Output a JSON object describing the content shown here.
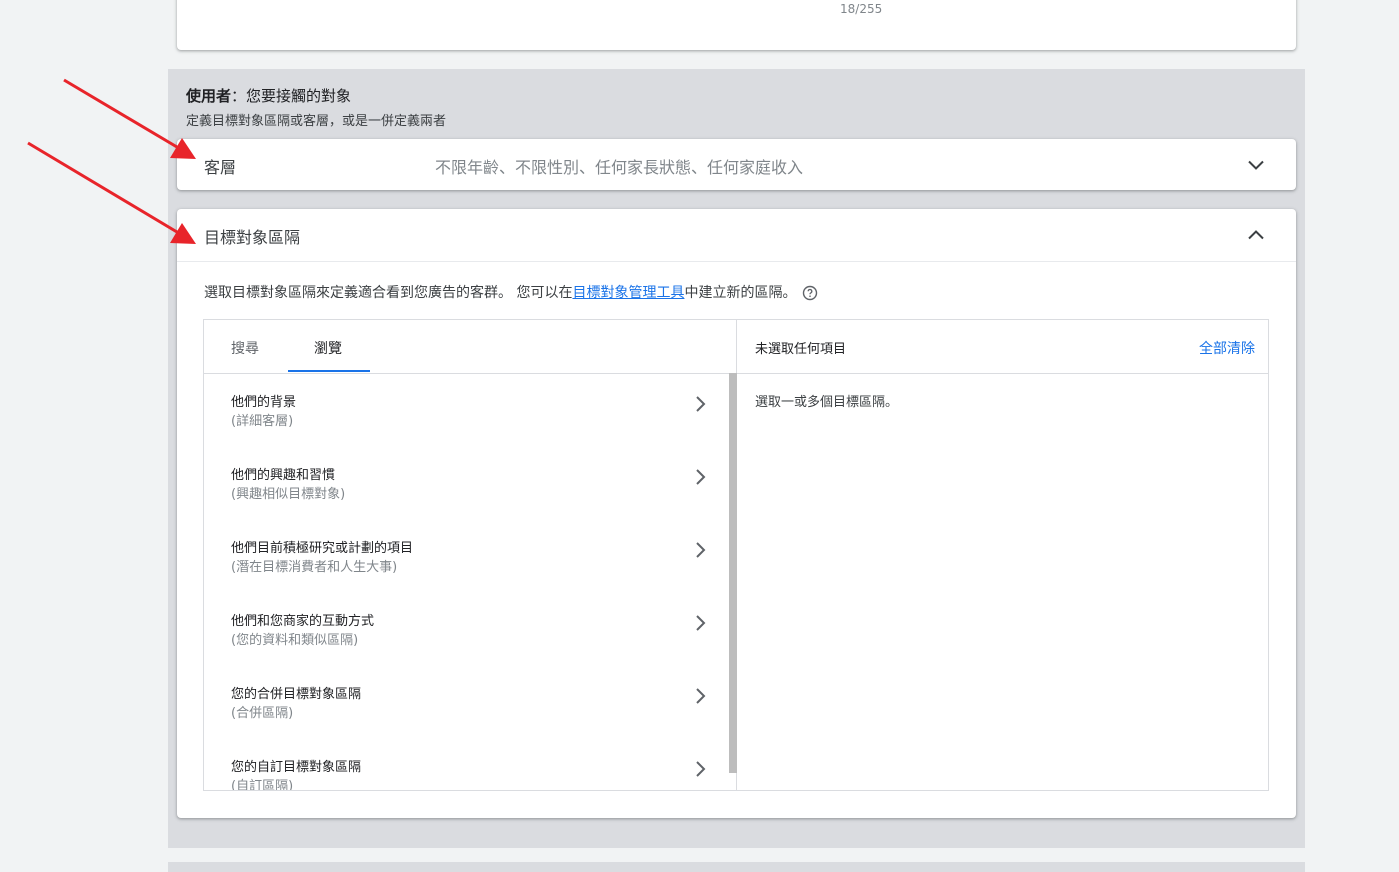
{
  "top_card": {
    "char_count": "18/255"
  },
  "section": {
    "title_bold": "使用者",
    "title_rest": "：您要接觸的對象",
    "subtitle": "定義目標對象區隔或客層，或是一併定義兩者"
  },
  "demographics": {
    "label": "客層",
    "summary": "不限年齡、不限性別、任何家長狀態、任何家庭收入"
  },
  "audience": {
    "label": "目標對象區隔",
    "desc_before": "選取目標對象區隔來定義適合看到您廣告的客群。 您可以在",
    "desc_link": "目標對象管理工具",
    "desc_after": "中建立新的區隔。",
    "tabs": [
      "搜尋",
      "瀏覽"
    ],
    "active_tab": "瀏覽",
    "items": [
      {
        "title": "他們的背景",
        "subtitle": "(詳細客層)"
      },
      {
        "title": "他們的興趣和習慣",
        "subtitle": "(興趣相似目標對象)"
      },
      {
        "title": "他們目前積極研究或計劃的項目",
        "subtitle": "(潛在目標消費者和人生大事)"
      },
      {
        "title": "他們和您商家的互動方式",
        "subtitle": "(您的資料和類似區隔)"
      },
      {
        "title": "您的合併目標對象區隔",
        "subtitle": "(合併區隔)"
      },
      {
        "title": "您的自訂目標對象區隔",
        "subtitle": "(自訂區隔)"
      }
    ],
    "selection_header": "未選取任何項目",
    "clear_all": "全部清除",
    "empty_hint": "選取一或多個目標區隔。"
  },
  "icons": {
    "expand": "chevron-down-icon",
    "collapse": "chevron-up-icon",
    "item_arrow": "chevron-right-icon",
    "help": "help-circle-icon",
    "annotation": "red-arrow-icon"
  },
  "colors": {
    "link": "#1a73e8",
    "annotation_arrow": "#e8242a",
    "panel_bg": "#dadce0"
  }
}
